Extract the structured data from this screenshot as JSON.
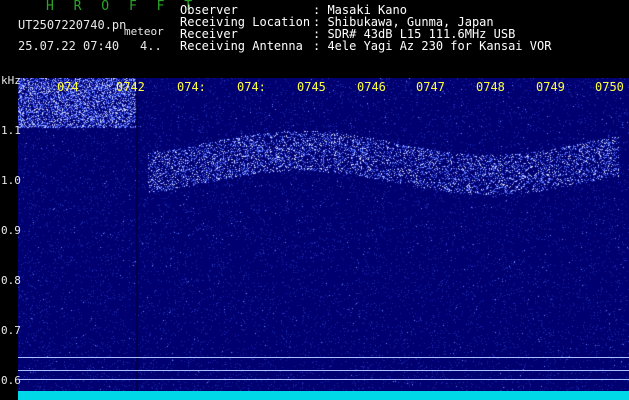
{
  "header": {
    "brand": "H R O F F T",
    "filename": "UT2507220740.pn",
    "type_label": "meteor",
    "datetime": "25.07.22 07:40",
    "count": "4.."
  },
  "info": [
    {
      "key": "Observer",
      "value": ": Masaki Kano"
    },
    {
      "key": "Receiving Location",
      "value": ": Shibukawa, Gunma, Japan"
    },
    {
      "key": "Receiver",
      "value": ": SDR# 43dB L15 111.6MHz USB"
    },
    {
      "key": "Receiving Antenna",
      "value": ": 4ele Yagi Az 230 for Kansai VOR"
    }
  ],
  "axis": {
    "unit": "kHz",
    "y_labels": [
      "1.1",
      "1.0",
      "0.9",
      "0.8",
      "0.7",
      "0.6"
    ],
    "x_labels": [
      "074",
      "0742",
      "074:",
      "074:",
      "0745",
      "0746",
      "0747",
      "0748",
      "0749",
      "0750"
    ]
  },
  "colors": {
    "background": "#000070",
    "trace": "#ffffff",
    "tick": "#ffff40",
    "brand": "#2aa52a"
  }
}
